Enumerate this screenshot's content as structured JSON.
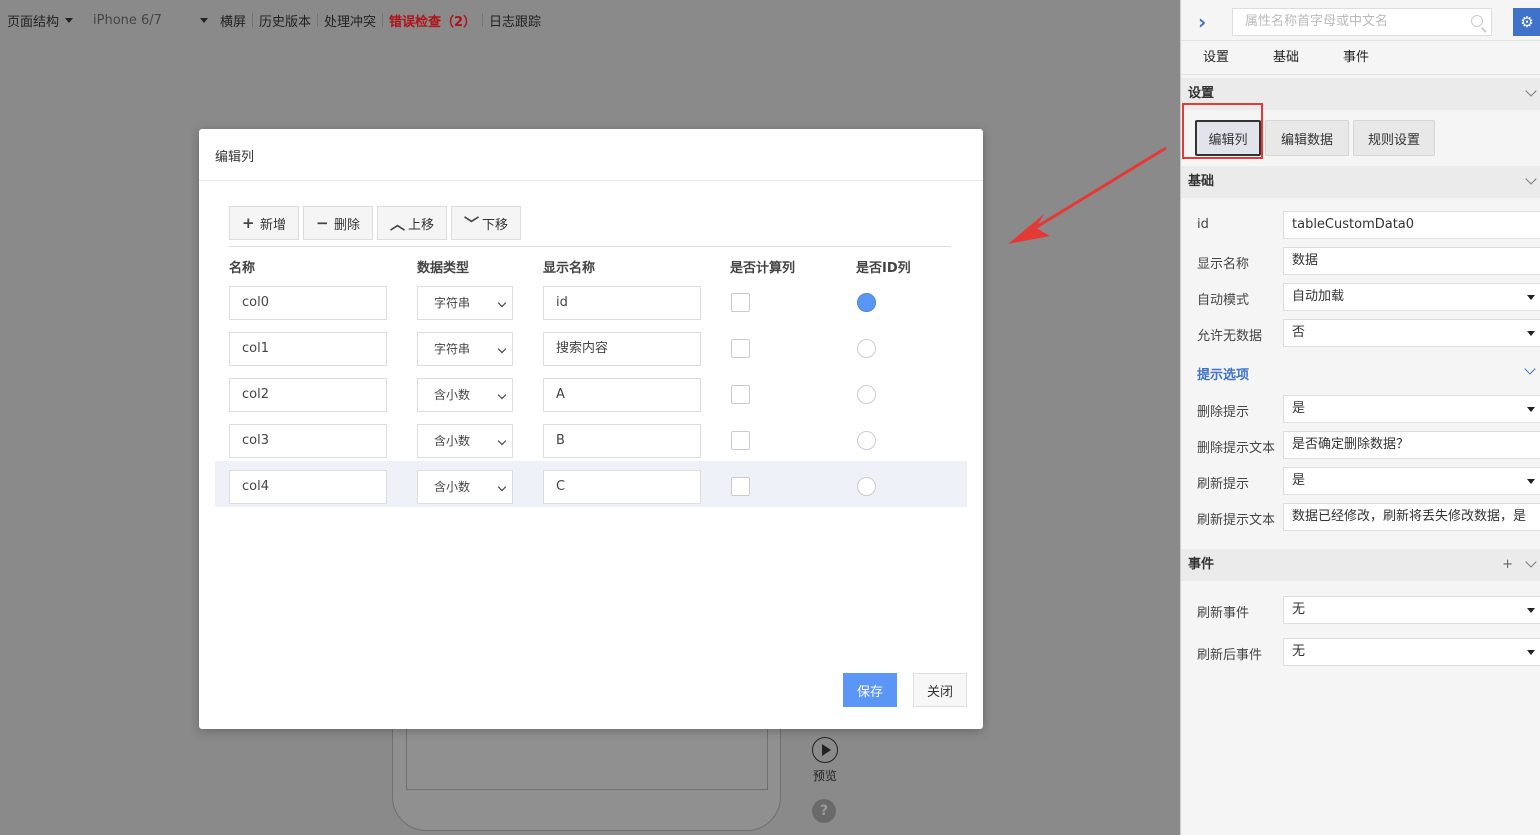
{
  "toolbar": {
    "page_structure": "页面结构",
    "device": "iPhone 6/7",
    "landscape": "横屏",
    "history": "历史版本",
    "conflict": "处理冲突",
    "error_check": "错误检查（2）",
    "log_trace": "日志跟踪"
  },
  "preview": {
    "label": "预览",
    "help": "?"
  },
  "modal": {
    "title": "编辑列",
    "buttons": {
      "add": "新增",
      "delete": "删除",
      "up": "上移",
      "down": "下移"
    },
    "headers": {
      "name": "名称",
      "data_type": "数据类型",
      "display_name": "显示名称",
      "is_calc": "是否计算列",
      "is_id": "是否ID列"
    },
    "rows": [
      {
        "name": "col0",
        "type": "字符串",
        "display": "id",
        "calc": false,
        "id": true
      },
      {
        "name": "col1",
        "type": "字符串",
        "display": "搜索内容",
        "calc": false,
        "id": false
      },
      {
        "name": "col2",
        "type": "含小数",
        "display": "A",
        "calc": false,
        "id": false
      },
      {
        "name": "col3",
        "type": "含小数",
        "display": "B",
        "calc": false,
        "id": false
      },
      {
        "name": "col4",
        "type": "含小数",
        "display": "C",
        "calc": false,
        "id": false
      }
    ],
    "selected_row": 4,
    "save": "保存",
    "close": "关闭"
  },
  "panel": {
    "search_placeholder": "属性名称首字母或中文名",
    "tabs": [
      "设置",
      "基础",
      "事件"
    ],
    "settings_title": "设置",
    "settings_buttons": [
      "编辑列",
      "编辑数据",
      "规则设置"
    ],
    "basic_title": "基础",
    "props": [
      {
        "label": "id",
        "value": "tableCustomData0",
        "dropdown": false
      },
      {
        "label": "显示名称",
        "value": "数据",
        "dropdown": false
      },
      {
        "label": "自动模式",
        "value": "自动加载",
        "dropdown": true
      },
      {
        "label": "允许无数据",
        "value": "否",
        "dropdown": true
      }
    ],
    "hint_title": "提示选项",
    "hint_props": [
      {
        "label": "删除提示",
        "value": "是",
        "dropdown": true
      },
      {
        "label": "删除提示文本",
        "value": "是否确定删除数据？",
        "dropdown": false
      },
      {
        "label": "刷新提示",
        "value": "是",
        "dropdown": true
      },
      {
        "label": "刷新提示文本",
        "value": "数据已经修改，刷新将丢失修改数据，是",
        "dropdown": false
      }
    ],
    "events_title": "事件",
    "events_plus": "+",
    "events": [
      {
        "label": "刷新事件",
        "value": "无"
      },
      {
        "label": "刷新后事件",
        "value": "无"
      }
    ]
  },
  "colors": {
    "accent": "#5b95f6",
    "brand": "#3f72c9",
    "error": "#b0121a",
    "highlight": "#e53935"
  }
}
